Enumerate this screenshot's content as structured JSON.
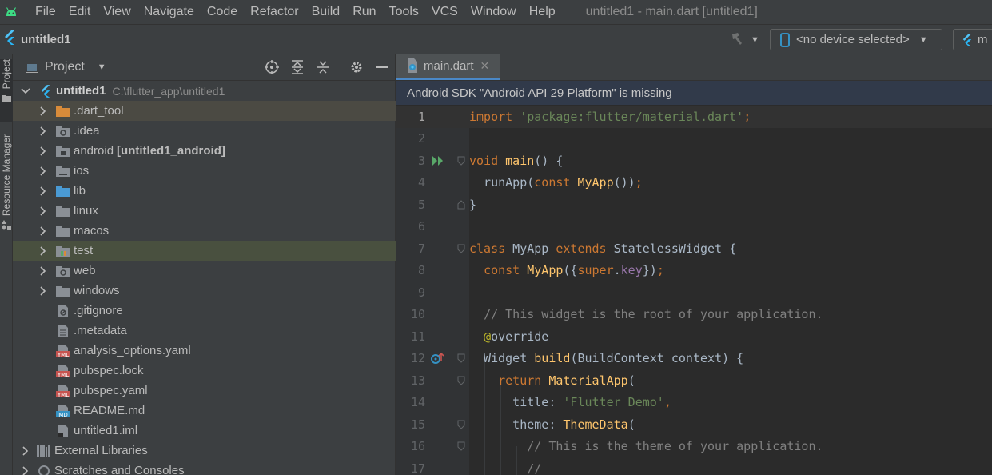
{
  "menubar": {
    "items": [
      "File",
      "Edit",
      "View",
      "Navigate",
      "Code",
      "Refactor",
      "Build",
      "Run",
      "Tools",
      "VCS",
      "Window",
      "Help"
    ],
    "window_title": "untitled1 - main.dart [untitled1]"
  },
  "navbar": {
    "project_name": "untitled1",
    "device_select": "<no device selected>",
    "config_select": "m"
  },
  "toolstrip": {
    "project_tab": "Project",
    "resource_manager_tab": "Resource Manager"
  },
  "project_panel": {
    "title": "Project",
    "root": {
      "label": "untitled1",
      "path": "C:\\flutter_app\\untitled1"
    },
    "items": [
      {
        "label": ".dart_tool",
        "bold_suffix": ""
      },
      {
        "label": ".idea",
        "bold_suffix": ""
      },
      {
        "label": "android",
        "bold_suffix": "[untitled1_android]"
      },
      {
        "label": "ios",
        "bold_suffix": ""
      },
      {
        "label": "lib",
        "bold_suffix": ""
      },
      {
        "label": "linux",
        "bold_suffix": ""
      },
      {
        "label": "macos",
        "bold_suffix": ""
      },
      {
        "label": "test",
        "bold_suffix": ""
      },
      {
        "label": "web",
        "bold_suffix": ""
      },
      {
        "label": "windows",
        "bold_suffix": ""
      },
      {
        "label": ".gitignore",
        "bold_suffix": ""
      },
      {
        "label": ".metadata",
        "bold_suffix": ""
      },
      {
        "label": "analysis_options.yaml",
        "bold_suffix": ""
      },
      {
        "label": "pubspec.lock",
        "bold_suffix": ""
      },
      {
        "label": "pubspec.yaml",
        "bold_suffix": ""
      },
      {
        "label": "README.md",
        "bold_suffix": ""
      },
      {
        "label": "untitled1.iml",
        "bold_suffix": ""
      }
    ],
    "external_libraries": "External Libraries",
    "scratches": "Scratches and Consoles"
  },
  "editor": {
    "tab_label": "main.dart",
    "banner": "Android SDK \"Android API 29 Platform\" is missing",
    "line_numbers": [
      "1",
      "2",
      "3",
      "4",
      "5",
      "6",
      "7",
      "8",
      "9",
      "10",
      "11",
      "12",
      "13",
      "14",
      "15",
      "16",
      "17"
    ]
  },
  "colors": {
    "keyword": "#cc7832",
    "string": "#6a8759",
    "function": "#ffc66d",
    "comment": "#808080",
    "annotation": "#bbb529",
    "field": "#9876aa",
    "flutter_blue": "#4fc3f7",
    "run_green": "#59a869"
  },
  "icons": [
    "android-icon",
    "flutter-icon",
    "hammer-icon",
    "phone-icon",
    "target-icon",
    "expand-all-icon",
    "collapse-all-icon",
    "gear-icon",
    "minimize-icon",
    "folder-icon",
    "run-icon",
    "override-icon"
  ]
}
